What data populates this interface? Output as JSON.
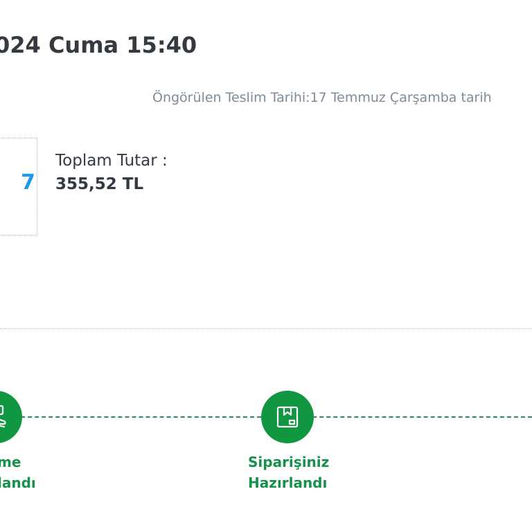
{
  "order": {
    "date_heading": "024 Cuma 15:40",
    "delivery_text": "Öngörülen Teslim Tarihi:17 Temmuz Çarşamba tarih",
    "thumb_text": "7",
    "total_label": "Toplam Tutar :",
    "total_value": "355,52 TL"
  },
  "timeline": {
    "steps": [
      {
        "line1": "me",
        "line2": "landı",
        "icon": "hand-card-icon",
        "state": "done"
      },
      {
        "line1": "Siparişiniz",
        "line2": "Hazırlandı",
        "icon": "package-icon",
        "state": "done"
      }
    ]
  },
  "colors": {
    "heading": "#343a40",
    "muted": "#7e8c9a",
    "accent_green": "#119641",
    "accent_blue": "#1e9be8"
  }
}
